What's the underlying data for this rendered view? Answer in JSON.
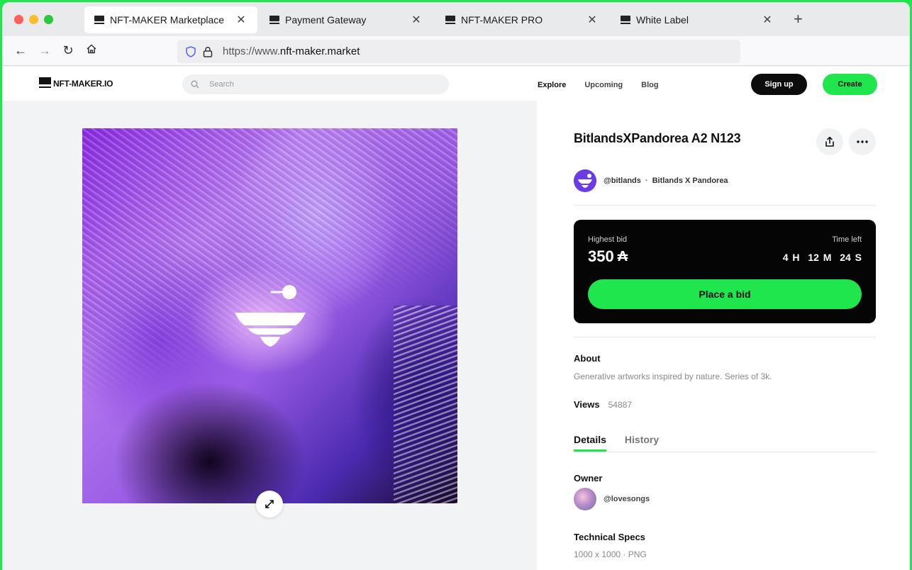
{
  "browser": {
    "tabs": [
      {
        "label": "NFT-MAKER Marketplace",
        "active": true
      },
      {
        "label": "Payment Gateway",
        "active": false
      },
      {
        "label": "NFT-MAKER PRO",
        "active": false
      },
      {
        "label": "White Label",
        "active": false
      }
    ],
    "url_prefix": "https://www.",
    "url_domain": "nft-maker.market"
  },
  "site": {
    "logo_text": "NFT-MAKER.IO",
    "search_placeholder": "Search",
    "nav": [
      "Explore",
      "Upcoming",
      "Blog"
    ],
    "signup_label": "Sign up",
    "create_label": "Create"
  },
  "nft": {
    "title": "BitlandsXPandorea A2 N123",
    "creator_handle": "@bitlands",
    "separator": "·",
    "collection": "Bitlands X Pandorea",
    "bid": {
      "highest_label": "Highest bid",
      "amount": "350",
      "currency_symbol": "₳",
      "time_label": "Time left",
      "time_left": "4 H  12 M  24 S",
      "button_label": "Place a bid"
    },
    "about_title": "About",
    "about_text": "Generative artworks inspired by nature. Series of 3k.",
    "views_label": "Views",
    "views_count": "54887",
    "tabs": [
      "Details",
      "History"
    ],
    "owner_title": "Owner",
    "owner_handle": "@lovesongs",
    "specs_title": "Technical Specs",
    "specs_text": "1000 x 1000 ·  PNG"
  },
  "colors": {
    "accent": "#1fe64c",
    "dark": "#050505"
  },
  "icons": [
    "shield-icon",
    "lock-icon",
    "back-icon",
    "forward-icon",
    "reload-icon",
    "home-icon",
    "search-icon",
    "share-icon",
    "more-icon",
    "expand-icon",
    "close-icon",
    "plus-icon"
  ]
}
